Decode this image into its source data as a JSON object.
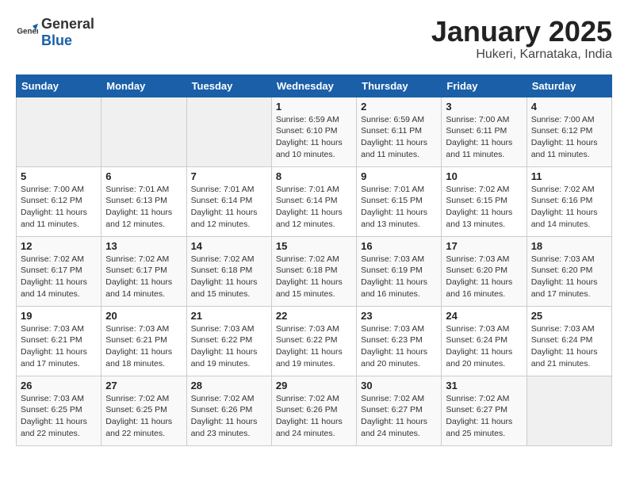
{
  "header": {
    "logo_general": "General",
    "logo_blue": "Blue",
    "title": "January 2025",
    "subtitle": "Hukeri, Karnataka, India"
  },
  "weekdays": [
    "Sunday",
    "Monday",
    "Tuesday",
    "Wednesday",
    "Thursday",
    "Friday",
    "Saturday"
  ],
  "weeks": [
    [
      {
        "day": "",
        "empty": true
      },
      {
        "day": "",
        "empty": true
      },
      {
        "day": "",
        "empty": true
      },
      {
        "day": "1",
        "sunrise": "6:59 AM",
        "sunset": "6:10 PM",
        "daylight": "11 hours and 10 minutes."
      },
      {
        "day": "2",
        "sunrise": "6:59 AM",
        "sunset": "6:11 PM",
        "daylight": "11 hours and 11 minutes."
      },
      {
        "day": "3",
        "sunrise": "7:00 AM",
        "sunset": "6:11 PM",
        "daylight": "11 hours and 11 minutes."
      },
      {
        "day": "4",
        "sunrise": "7:00 AM",
        "sunset": "6:12 PM",
        "daylight": "11 hours and 11 minutes."
      }
    ],
    [
      {
        "day": "5",
        "sunrise": "7:00 AM",
        "sunset": "6:12 PM",
        "daylight": "11 hours and 11 minutes."
      },
      {
        "day": "6",
        "sunrise": "7:01 AM",
        "sunset": "6:13 PM",
        "daylight": "11 hours and 12 minutes."
      },
      {
        "day": "7",
        "sunrise": "7:01 AM",
        "sunset": "6:14 PM",
        "daylight": "11 hours and 12 minutes."
      },
      {
        "day": "8",
        "sunrise": "7:01 AM",
        "sunset": "6:14 PM",
        "daylight": "11 hours and 12 minutes."
      },
      {
        "day": "9",
        "sunrise": "7:01 AM",
        "sunset": "6:15 PM",
        "daylight": "11 hours and 13 minutes."
      },
      {
        "day": "10",
        "sunrise": "7:02 AM",
        "sunset": "6:15 PM",
        "daylight": "11 hours and 13 minutes."
      },
      {
        "day": "11",
        "sunrise": "7:02 AM",
        "sunset": "6:16 PM",
        "daylight": "11 hours and 14 minutes."
      }
    ],
    [
      {
        "day": "12",
        "sunrise": "7:02 AM",
        "sunset": "6:17 PM",
        "daylight": "11 hours and 14 minutes."
      },
      {
        "day": "13",
        "sunrise": "7:02 AM",
        "sunset": "6:17 PM",
        "daylight": "11 hours and 14 minutes."
      },
      {
        "day": "14",
        "sunrise": "7:02 AM",
        "sunset": "6:18 PM",
        "daylight": "11 hours and 15 minutes."
      },
      {
        "day": "15",
        "sunrise": "7:02 AM",
        "sunset": "6:18 PM",
        "daylight": "11 hours and 15 minutes."
      },
      {
        "day": "16",
        "sunrise": "7:03 AM",
        "sunset": "6:19 PM",
        "daylight": "11 hours and 16 minutes."
      },
      {
        "day": "17",
        "sunrise": "7:03 AM",
        "sunset": "6:20 PM",
        "daylight": "11 hours and 16 minutes."
      },
      {
        "day": "18",
        "sunrise": "7:03 AM",
        "sunset": "6:20 PM",
        "daylight": "11 hours and 17 minutes."
      }
    ],
    [
      {
        "day": "19",
        "sunrise": "7:03 AM",
        "sunset": "6:21 PM",
        "daylight": "11 hours and 17 minutes."
      },
      {
        "day": "20",
        "sunrise": "7:03 AM",
        "sunset": "6:21 PM",
        "daylight": "11 hours and 18 minutes."
      },
      {
        "day": "21",
        "sunrise": "7:03 AM",
        "sunset": "6:22 PM",
        "daylight": "11 hours and 19 minutes."
      },
      {
        "day": "22",
        "sunrise": "7:03 AM",
        "sunset": "6:22 PM",
        "daylight": "11 hours and 19 minutes."
      },
      {
        "day": "23",
        "sunrise": "7:03 AM",
        "sunset": "6:23 PM",
        "daylight": "11 hours and 20 minutes."
      },
      {
        "day": "24",
        "sunrise": "7:03 AM",
        "sunset": "6:24 PM",
        "daylight": "11 hours and 20 minutes."
      },
      {
        "day": "25",
        "sunrise": "7:03 AM",
        "sunset": "6:24 PM",
        "daylight": "11 hours and 21 minutes."
      }
    ],
    [
      {
        "day": "26",
        "sunrise": "7:03 AM",
        "sunset": "6:25 PM",
        "daylight": "11 hours and 22 minutes."
      },
      {
        "day": "27",
        "sunrise": "7:02 AM",
        "sunset": "6:25 PM",
        "daylight": "11 hours and 22 minutes."
      },
      {
        "day": "28",
        "sunrise": "7:02 AM",
        "sunset": "6:26 PM",
        "daylight": "11 hours and 23 minutes."
      },
      {
        "day": "29",
        "sunrise": "7:02 AM",
        "sunset": "6:26 PM",
        "daylight": "11 hours and 24 minutes."
      },
      {
        "day": "30",
        "sunrise": "7:02 AM",
        "sunset": "6:27 PM",
        "daylight": "11 hours and 24 minutes."
      },
      {
        "day": "31",
        "sunrise": "7:02 AM",
        "sunset": "6:27 PM",
        "daylight": "11 hours and 25 minutes."
      },
      {
        "day": "",
        "empty": true
      }
    ]
  ]
}
